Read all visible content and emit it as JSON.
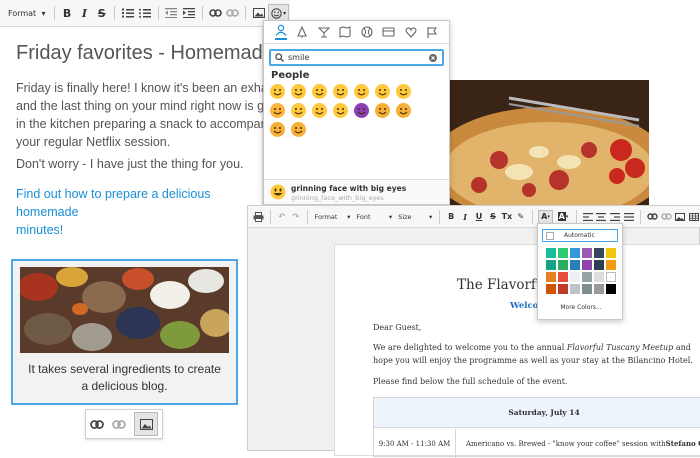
{
  "toolbar1": {
    "format_label": "Format"
  },
  "post": {
    "title": "Friday favorites - Homemade pi",
    "para1": "Friday is finally here! I know it's been an exhau\nand the last thing on your mind right now is ge\nin the kitchen preparing a snack to accompany\nyour regular Netflix session.",
    "para2": "Don't worry - I have just the thing for you.",
    "link": "Find out how to prepare a delicious homemade\nminutes!",
    "caption": "It takes several ingredients to create\na delicious blog."
  },
  "emoji_panel": {
    "search_value": "smile",
    "group_label": "People",
    "selected_name": "grinning face with big eyes",
    "selected_shortcode": "grinning_face_with_big_eyes",
    "emojis": [
      {
        "name": "grinning-face",
        "color": "#ffc83d"
      },
      {
        "name": "grinning-face-big-eyes",
        "color": "#ffc83d"
      },
      {
        "name": "grinning-face-smiling-eyes",
        "color": "#ffc83d"
      },
      {
        "name": "grinning-face-sweat",
        "color": "#ffc83d"
      },
      {
        "name": "smiling-face-smiling-eyes",
        "color": "#ffc83d"
      },
      {
        "name": "slightly-smiling-face",
        "color": "#ffc83d"
      },
      {
        "name": "upside-down-face",
        "color": "#ffc83d"
      },
      {
        "name": "heart-eyes-face",
        "color": "#ffb43d"
      },
      {
        "name": "smiling-face-hearts",
        "color": "#ffc83d"
      },
      {
        "name": "smiling-face",
        "color": "#ffc83d"
      },
      {
        "name": "smirking-face",
        "color": "#ffc83d"
      },
      {
        "name": "smiling-imp",
        "color": "#8a3fb6"
      },
      {
        "name": "grinning-cat",
        "color": "#f5b035"
      },
      {
        "name": "grinning-cat-smiling-eyes",
        "color": "#f5b035"
      },
      {
        "name": "heart-eyes-cat",
        "color": "#f5b035"
      },
      {
        "name": "smirk-cat",
        "color": "#f5b035"
      }
    ]
  },
  "toolbar2": {
    "format_label": "Format",
    "font_label": "Font",
    "size_label": "Size"
  },
  "letter": {
    "title": "The Flavorful Tu",
    "welcome": "Welcom",
    "greeting": "Dear Guest,",
    "intro_pre": "We are delighted to welcome you to the annual ",
    "intro_em": "Flavorful Tuscany Meetup",
    "intro_post": " and hope you will enjoy the programme as well as your stay at the Bilancino Hotel.",
    "schedule_intro": "Please find below the full schedule of the event.",
    "day": "Saturday, July 14",
    "time": "9:30 AM - 11:30 AM",
    "event_pre": "Americano vs. Brewed - \"know your coffee\" session with ",
    "event_strong": "Stefano Garau"
  },
  "color_panel": {
    "automatic_label": "Automatic",
    "more_label": "More Colors...",
    "colors": [
      "#1abc9c",
      "#2ecc71",
      "#3498db",
      "#9b59b6",
      "#34495e",
      "#f1c40f",
      "#16a085",
      "#27ae60",
      "#2980b9",
      "#8e44ad",
      "#2c3e50",
      "#f39c12",
      "#e67e22",
      "#e74c3c",
      "#ecf0f1",
      "#95a5a6",
      "#dddddd",
      "#ffffff",
      "#d35400",
      "#c0392b",
      "#bdc3c7",
      "#7f8c8d",
      "#999999",
      "#000000"
    ]
  }
}
